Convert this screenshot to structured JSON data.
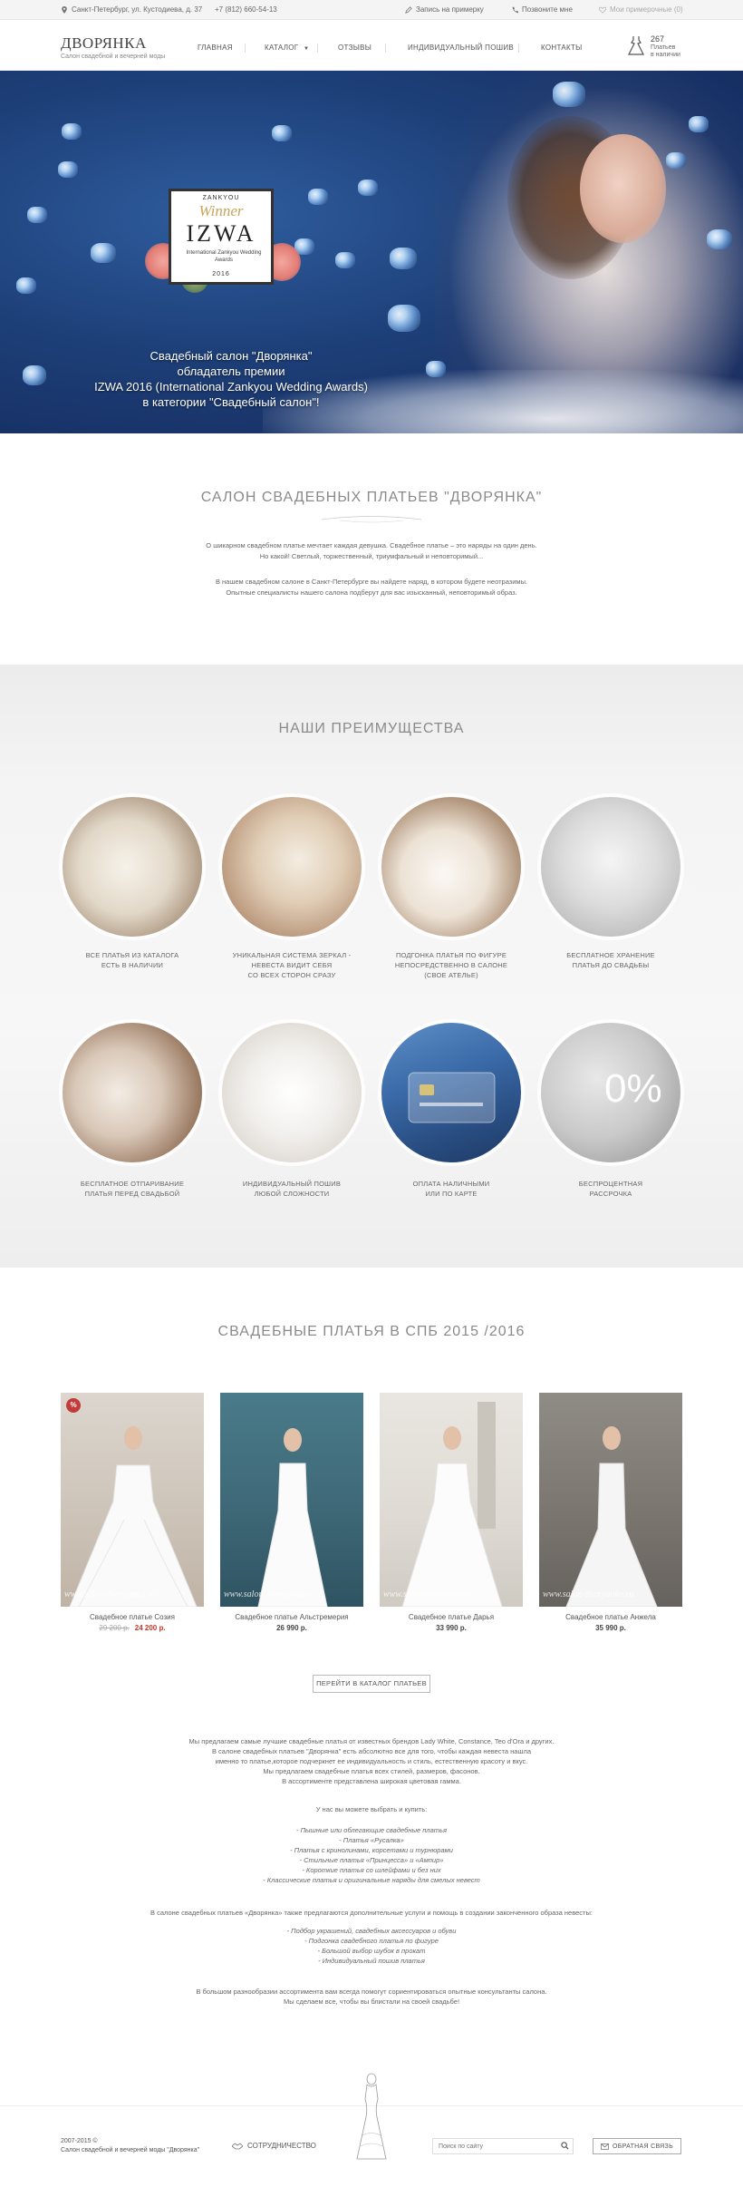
{
  "topbar": {
    "address": "Санкт-Петербург, ул. Кустодиева, д. 37",
    "phone": "+7 (812) 660-54-13",
    "fitting": "Запись на примерку",
    "callback": "Позвоните мне",
    "my_fittings": "Мои примерочные (0)"
  },
  "header": {
    "logo_title": "ДВОРЯНКА",
    "logo_subtitle": "Салон свадебной и вечерней моды",
    "nav": [
      {
        "label": "ГЛАВНАЯ"
      },
      {
        "label": "КАТАЛОГ"
      },
      {
        "label": "ОТЗЫВЫ"
      },
      {
        "label": "ИНДИВИДУАЛЬНЫЙ ПОШИВ"
      },
      {
        "label": "КОНТАКТЫ"
      }
    ],
    "stock_count": "267",
    "stock_line1": "Платьев",
    "stock_line2": "в наличии"
  },
  "hero": {
    "badge_top": "ZANKYOU",
    "badge_winner": "Winner",
    "badge_main": "IZWA",
    "badge_sub": "International Zankyou Wedding Awards",
    "badge_year": "2016",
    "line1": "Свадебный салон \"Дворянка\"",
    "line2": "обладатель премии",
    "line3": "IZWA 2016 (International Zankyou Wedding Awards)",
    "line4": "в категории \"Свадебный салон\"!"
  },
  "about": {
    "title": "САЛОН СВАДЕБНЫХ ПЛАТЬЕВ \"ДВОРЯНКА\"",
    "p1_l1": "О шикарном свадебном платье мечтает каждая девушка. Свадебное платье – это наряды на один день.",
    "p1_l2": "Но какой! Светлый, торжественный, триумфальный и неповторимый...",
    "p2_l1": "В нашем свадебном салоне в Санкт-Петербурге вы найдете наряд, в котором будете неотразимы.",
    "p2_l2": "Опытные специалисты нашего салона подберут для вас изысканный, неповторимый образ."
  },
  "advantages": {
    "title": "НАШИ ПРЕИМУЩЕСТВА",
    "items": [
      {
        "l1": "ВСЕ ПЛАТЬЯ ИЗ КАТАЛОГА",
        "l2": "ЕСТЬ В НАЛИЧИИ",
        "l3": ""
      },
      {
        "l1": "УНИКАЛЬНАЯ СИСТЕМА ЗЕРКАЛ -",
        "l2": "НЕВЕСТА ВИДИТ СЕБЯ",
        "l3": "СО ВСЕХ СТОРОН СРАЗУ"
      },
      {
        "l1": "ПОДГОНКА ПЛАТЬЯ ПО ФИГУРЕ",
        "l2": "НЕПОСРЕДСТВЕННО В САЛОНЕ",
        "l3": "(СВОЕ АТЕЛЬЕ)"
      },
      {
        "l1": "БЕСПЛАТНОЕ ХРАНЕНИЕ",
        "l2": "ПЛАТЬЯ ДО СВАДЬБЫ",
        "l3": ""
      },
      {
        "l1": "БЕСПЛАТНОЕ ОТПАРИВАНИЕ",
        "l2": "ПЛАТЬЯ ПЕРЕД СВАДЬБОЙ",
        "l3": ""
      },
      {
        "l1": "ИНДИВИДУАЛЬНЫЙ ПОШИВ",
        "l2": "ЛЮБОЙ СЛОЖНОСТИ",
        "l3": ""
      },
      {
        "l1": "ОПЛАТА НАЛИЧНЫМИ",
        "l2": "ИЛИ ПО КАРТЕ",
        "l3": ""
      },
      {
        "l1": "БЕСПРОЦЕНТНАЯ",
        "l2": "РАССРОЧКА",
        "l3": ""
      }
    ],
    "percent_text": "0%"
  },
  "catalog": {
    "title": "СВАДЕБНЫЕ ПЛАТЬЯ В СПБ 2015 /2016",
    "watermark": "www.salon-dvoryanka.ru",
    "sale_badge": "%",
    "products": [
      {
        "name": "Свадебное платье Созия",
        "old_price": "29 200 р.",
        "price": "24 200 р."
      },
      {
        "name": "Свадебное платье Альстремерия",
        "old_price": "",
        "price": "26 990 р."
      },
      {
        "name": "Свадебное платье Дарья",
        "old_price": "",
        "price": "33 990 р."
      },
      {
        "name": "Свадебное платье Анжела",
        "old_price": "",
        "price": "35 990 р."
      }
    ],
    "button": "ПЕРЕЙТИ В КАТАЛОГ ПЛАТЬЕВ"
  },
  "description": {
    "intro": [
      "Мы предлагаем самые лучшие свадебные платья от известных брендов Lady White, Constance, Teo d'Ora и других.",
      "В салоне свадебных платьев \"Дворянка\" есть абсолютно все для того, чтобы каждая невеста нашла",
      "именно то платье,которое подчеркнет ее индивидуальность и стиль, естественную красоту и вкус.",
      "Мы предлагаем свадебные платья всех стилей, размеров, фасонов.",
      "В ассортименте представлена широкая цветовая гамма."
    ],
    "buy_title": "У нас вы можете выбрать и купить:",
    "buy_list": [
      "- Пышные или облегающие свадебные платья",
      "- Платья «Русалка»",
      "- Платья с кринолинами, корсетами и турнюрами",
      "- Стильные платья «Принцесса» и «Ампир»",
      "- Короткие платья со шлейфами и без них",
      "- Классические платья и оригинальные наряды для смелых невест"
    ],
    "services_title": "В салоне свадебных платьев «Дворянка» также предлагаются дополнительные услуги и помощь в создании законченного образа невесты:",
    "services_list": [
      "- Подбор украшений, свадебных аксессуаров и обуви",
      "- Подгонка свадебного платья по фигуре",
      "- Большой выбор шубок в прокат",
      "- Индивидуальный пошив платья"
    ],
    "closing1": "В большом разнообразии ассортимента вам всегда помогут сориентироваться опытные консультанты салона.",
    "closing2": "Мы сделаем все, чтобы вы блистали на своей свадьбе!"
  },
  "footer": {
    "copy1": "2007-2015 ©",
    "copy2": "Салон свадебной и вечерней моды \"Дворянка\"",
    "cooperation": "СОТРУДНИЧЕСТВО",
    "search_placeholder": "Поиск по сайту",
    "feedback": "ОБРАТНАЯ СВЯЗЬ"
  }
}
